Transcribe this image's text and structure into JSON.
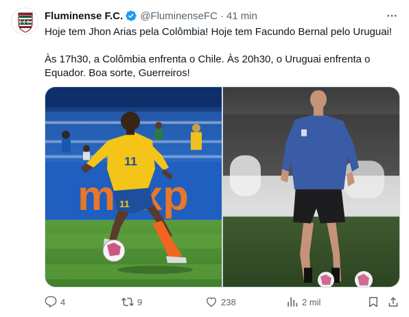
{
  "tweet": {
    "display_name": "Fluminense F.C.",
    "handle": "@FluminenseFC",
    "separator": "·",
    "time": "41 min",
    "text_line1": "Hoje tem Jhon Arias pela Colômbia! Hoje tem Facundo Bernal pelo Uruguai!",
    "text_line2": "Às 17h30, a Colômbia enfrenta o Chile. Às 20h30, o Uruguai enfrenta o Equador. Boa sorte, Guerreiros!",
    "avatar_monogram": "FFC",
    "colors": {
      "club_garnet": "#8b1d2c",
      "club_green": "#00613c",
      "verified_blue": "#1d9bf0",
      "muted_text": "#536471"
    }
  },
  "media": {
    "left_shirt_number": "11",
    "left_ad_text": "maxp"
  },
  "actions": {
    "reply_icon": "reply-icon",
    "reply_count": "4",
    "retweet_icon": "retweet-icon",
    "retweet_count": "9",
    "like_icon": "heart-icon",
    "like_count": "238",
    "views_icon": "views-chart-icon",
    "views_count": "2 mil",
    "bookmark_icon": "bookmark-icon",
    "share_icon": "share-icon"
  }
}
